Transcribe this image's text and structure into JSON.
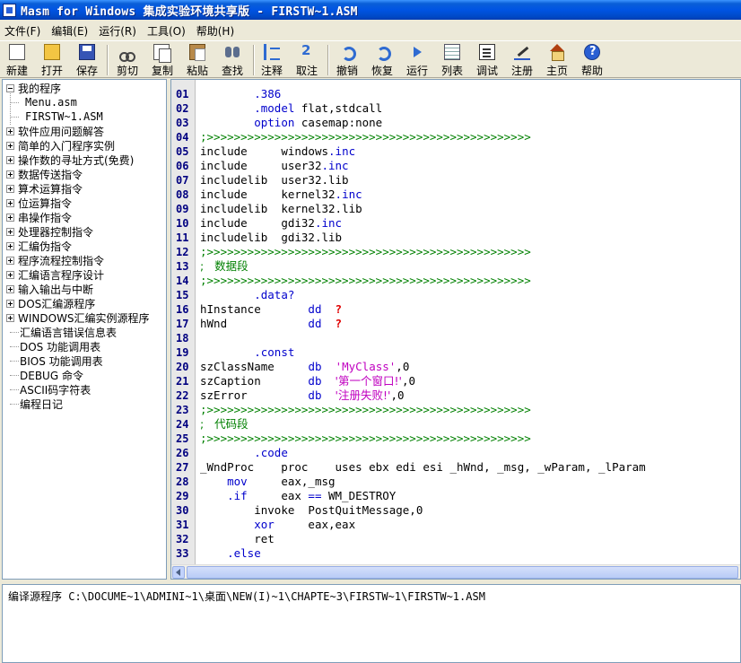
{
  "window": {
    "title": "Masm for Windows 集成实验环境共享版 - FIRSTW~1.ASM"
  },
  "menu": [
    "文件(F)",
    "编辑(E)",
    "运行(R)",
    "工具(O)",
    "帮助(H)"
  ],
  "toolbar": {
    "new": "新建",
    "open": "打开",
    "save": "保存",
    "cut": "剪切",
    "copy": "复制",
    "paste": "粘贴",
    "find": "查找",
    "comment": "注释",
    "uncomment": "取注",
    "undo": "撤销",
    "redo": "恢复",
    "run": "运行",
    "list": "列表",
    "debug": "调试",
    "register": "注册",
    "home": "主页",
    "help": "帮助"
  },
  "tree": {
    "root": "我的程序",
    "children": [
      "Menu.asm",
      "FIRSTW~1.ASM"
    ],
    "items": [
      "软件应用问题解答",
      "简单的入门程序实例",
      "操作数的寻址方式(免费)",
      "数据传送指令",
      "算术运算指令",
      "位运算指令",
      "串操作指令",
      "处理器控制指令",
      "汇编伪指令",
      "程序流程控制指令",
      "汇编语言程序设计",
      "输入输出与中断",
      "DOS汇编源程序",
      "WINDOWS汇编实例源程序"
    ],
    "leaves": [
      "汇编语言错误信息表",
      "DOS 功能调用表",
      "BIOS 功能调用表",
      "DEBUG 命令",
      "ASCII码字符表",
      "编程日记"
    ]
  },
  "code": {
    "l01": "01",
    "l02": "02",
    "l03": "03",
    "l04": "04",
    "l05": "05",
    "l06": "06",
    "l07": "07",
    "l08": "08",
    "l09": "09",
    "l10": "10",
    "l11": "11",
    "l12": "12",
    "l13": "13",
    "l14": "14",
    "l15": "15",
    "l16": "16",
    "l17": "17",
    "l18": "18",
    "l19": "19",
    "l20": "20",
    "l21": "21",
    "l22": "22",
    "l23": "23",
    "l24": "24",
    "l25": "25",
    "l26": "26",
    "l27": "27",
    "l28": "28",
    "l29": "29",
    "l30": "30",
    "l31": "31",
    "l32": "32",
    "l33": "33",
    "separator": ";>>>>>>>>>>>>>>>>>>>>>>>>>>>>>>>>>>>>>>>>>>>>>>>>",
    "s386": ".386",
    "smodel": ".model",
    "smodel_args": " flat,stdcall",
    "soption": "option",
    "soption_args": " casemap:none",
    "include": "include",
    "includelib": "includelib",
    "windows_base": "windows",
    "user32_base": "user32",
    "kernel32_base": "kernel32",
    "gdi32_base": "gdi32",
    "ext_inc": ".inc",
    "ext_lib": ".lib",
    "comment_data": ";   数据段",
    "comment_code": ";   代码段",
    "sdata": ".data?",
    "hInstance": "hInstance",
    "hWnd": "hWnd",
    "dd": "dd",
    "q": "?",
    "sconst": ".const",
    "szClassName": "szClassName",
    "szCaption": "szCaption",
    "szError": "szError",
    "db": "db",
    "str_class": "'MyClass'",
    "str_caption": "'第一个窗口!'",
    "str_error": "'注册失败!'",
    "zero": ",0",
    "scode": ".code",
    "wndproc": "_WndProc    proc    uses ebx edi esi _hWnd, _msg, _wParam, _lParam",
    "mov": "mov",
    "mov_args": "     eax,_msg",
    "sif": ".if",
    "if_args": "     eax ",
    "eqeq": "==",
    "if_tail": " WM_DESTROY",
    "invoke_line": "invoke  PostQuitMessage,0",
    "xor": "xor",
    "xor_args": "     eax,eax",
    "ret": "ret",
    "selse": ".else"
  },
  "output": {
    "text": "编译源程序 C:\\DOCUME~1\\ADMINI~1\\桌面\\NEW(I)~1\\CHAPTE~3\\FIRSTW~1\\FIRSTW~1.ASM"
  }
}
